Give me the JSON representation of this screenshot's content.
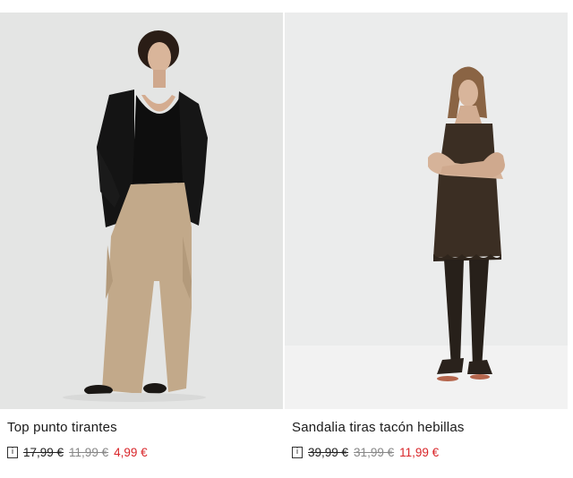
{
  "products": [
    {
      "name": "Top punto tirantes",
      "price_original": "17,99 €",
      "price_previous": "11,99 €",
      "price_sale": "4,99 €"
    },
    {
      "name": "Sandalia tiras tacón hebillas",
      "price_original": "39,99 €",
      "price_previous": "31,99 €",
      "price_sale": "11,99 €"
    }
  ],
  "info_icon_glyph": "i",
  "colors": {
    "sale_price": "#d9262a",
    "previous_price": "#888888",
    "text": "#1a1a1a"
  }
}
